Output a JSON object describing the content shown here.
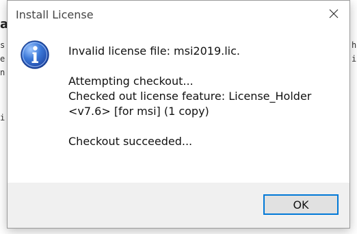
{
  "background": {
    "fragments": [
      "a",
      "s",
      "e",
      "n",
      "i",
      "h",
      "i"
    ]
  },
  "dialog": {
    "title": "Install License",
    "close_icon": "close-icon",
    "info_icon": "info-icon",
    "message_lines": [
      "Invalid license file: msi2019.lic.",
      "",
      "Attempting checkout...",
      "Checked out license feature: License_Holder",
      "<v7.6> [for msi] (1 copy)",
      "",
      "Checkout succeeded..."
    ],
    "ok_label": "OK"
  },
  "colors": {
    "accent": "#0078d7",
    "footer_bg": "#f0f0f0",
    "icon_blue": "#2a5fc4"
  }
}
